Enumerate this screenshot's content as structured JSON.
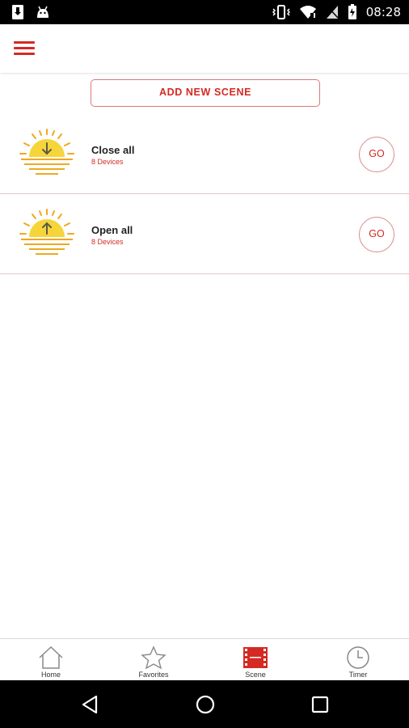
{
  "status_bar": {
    "time": "08:28",
    "icons": [
      "download-notification-icon",
      "android-icon",
      "vibrate-icon",
      "wifi-icon",
      "no-sim-icon",
      "battery-icon"
    ]
  },
  "header": {
    "menu_icon": "hamburger-menu-icon"
  },
  "actions": {
    "add_scene_label": "ADD NEW SCENE"
  },
  "scenes": [
    {
      "title": "Close all",
      "subtitle": "8 Devices",
      "icon": "sunset-down-arrow-icon",
      "go_label": "GO"
    },
    {
      "title": "Open all",
      "subtitle": "8 Devices",
      "icon": "sunrise-up-arrow-icon",
      "go_label": "GO"
    }
  ],
  "tabs": [
    {
      "label": "Home",
      "icon": "home-icon",
      "active": false
    },
    {
      "label": "Favorites",
      "icon": "star-icon",
      "active": false
    },
    {
      "label": "Scene",
      "icon": "film-scene-icon",
      "active": true
    },
    {
      "label": "Timer",
      "icon": "clock-icon",
      "active": false
    }
  ],
  "nav": {
    "icons": [
      "back-icon",
      "home-circle-icon",
      "recents-icon"
    ]
  },
  "colors": {
    "accent": "#d42a23",
    "sun": "#f5d53a",
    "sun_rays": "#f0a81e",
    "divider": "#e3c6c4"
  }
}
